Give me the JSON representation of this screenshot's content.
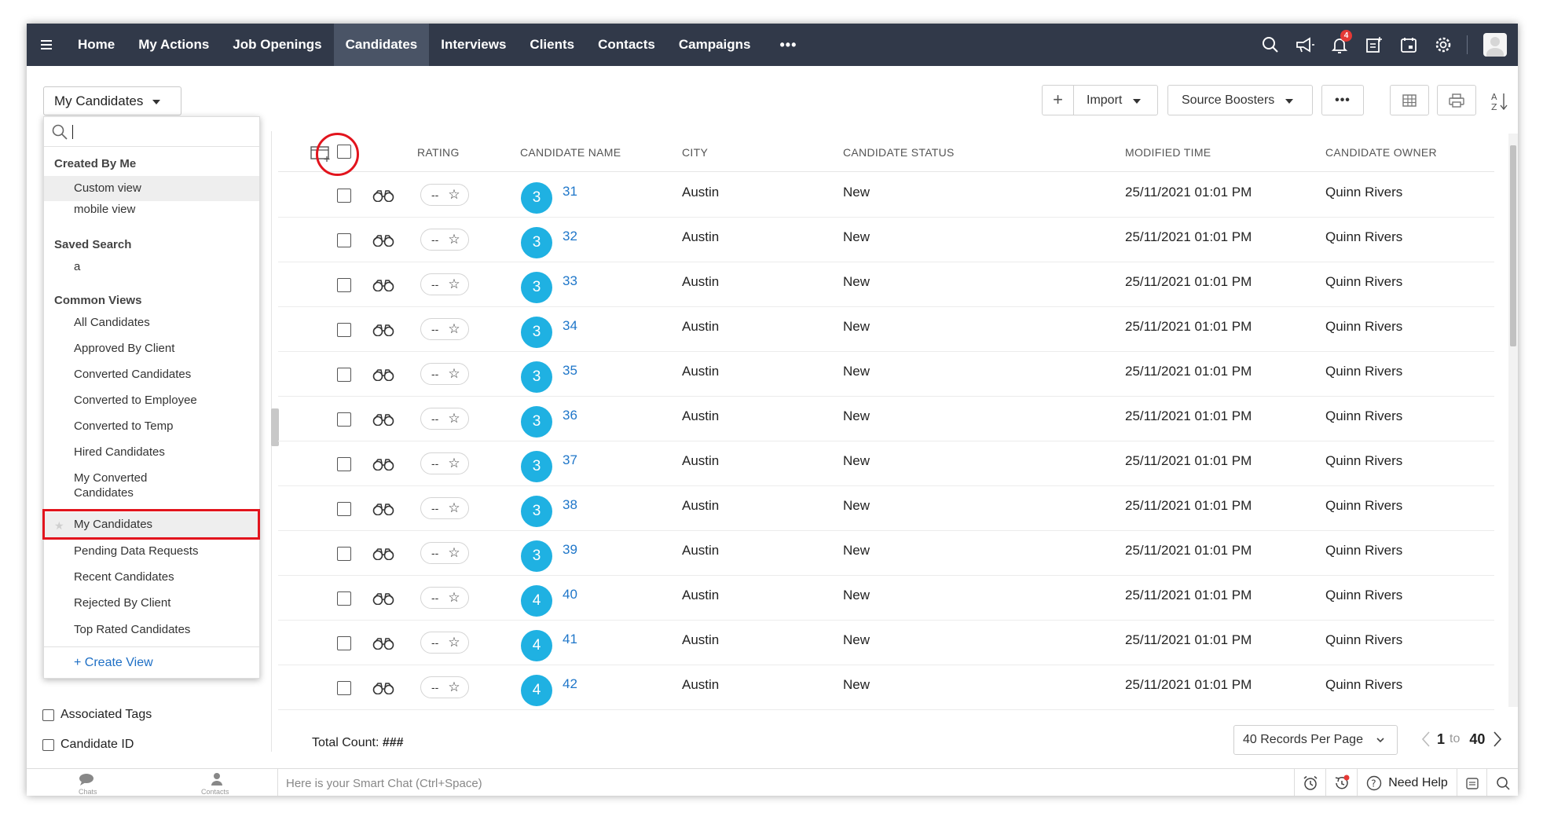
{
  "nav": {
    "tabs": [
      "Home",
      "My Actions",
      "Job Openings",
      "Candidates",
      "Interviews",
      "Clients",
      "Contacts",
      "Campaigns"
    ],
    "active": "Candidates",
    "more": "•••",
    "notification_count": "4"
  },
  "toolbar": {
    "view_select": "My Candidates",
    "plus": "+",
    "import": "Import",
    "source_boosters": "Source Boosters",
    "more": "•••"
  },
  "dropdown": {
    "search_placeholder": "",
    "created_by_me": "Created By Me",
    "created_items": [
      "Custom view",
      "mobile view"
    ],
    "saved_search": "Saved Search",
    "saved_items": [
      "a"
    ],
    "common_views": "Common Views",
    "common_items": [
      "All Candidates",
      "Approved By Client",
      "Converted Candidates",
      "Converted to Employee",
      "Converted to Temp",
      "Hired Candidates",
      "My Converted Candidates",
      "My Candidates",
      "Pending Data Requests",
      "Recent Candidates",
      "Rejected By Client",
      "Top Rated Candidates"
    ],
    "create_view": "+ Create View"
  },
  "left_panel": {
    "filters": [
      "Associated Tags",
      "Candidate ID"
    ]
  },
  "table": {
    "headers": {
      "rating": "RATING",
      "name": "CANDIDATE NAME",
      "city": "CITY",
      "status": "CANDIDATE STATUS",
      "modified": "MODIFIED TIME",
      "owner": "CANDIDATE OWNER"
    },
    "rows": [
      {
        "avatar": "3",
        "name": "31",
        "rating": "--",
        "city": "Austin",
        "status": "New",
        "modified": "25/11/2021 01:01 PM",
        "owner": "Quinn Rivers"
      },
      {
        "avatar": "3",
        "name": "32",
        "rating": "--",
        "city": "Austin",
        "status": "New",
        "modified": "25/11/2021 01:01 PM",
        "owner": "Quinn Rivers"
      },
      {
        "avatar": "3",
        "name": "33",
        "rating": "--",
        "city": "Austin",
        "status": "New",
        "modified": "25/11/2021 01:01 PM",
        "owner": "Quinn Rivers"
      },
      {
        "avatar": "3",
        "name": "34",
        "rating": "--",
        "city": "Austin",
        "status": "New",
        "modified": "25/11/2021 01:01 PM",
        "owner": "Quinn Rivers"
      },
      {
        "avatar": "3",
        "name": "35",
        "rating": "--",
        "city": "Austin",
        "status": "New",
        "modified": "25/11/2021 01:01 PM",
        "owner": "Quinn Rivers"
      },
      {
        "avatar": "3",
        "name": "36",
        "rating": "--",
        "city": "Austin",
        "status": "New",
        "modified": "25/11/2021 01:01 PM",
        "owner": "Quinn Rivers"
      },
      {
        "avatar": "3",
        "name": "37",
        "rating": "--",
        "city": "Austin",
        "status": "New",
        "modified": "25/11/2021 01:01 PM",
        "owner": "Quinn Rivers"
      },
      {
        "avatar": "3",
        "name": "38",
        "rating": "--",
        "city": "Austin",
        "status": "New",
        "modified": "25/11/2021 01:01 PM",
        "owner": "Quinn Rivers"
      },
      {
        "avatar": "3",
        "name": "39",
        "rating": "--",
        "city": "Austin",
        "status": "New",
        "modified": "25/11/2021 01:01 PM",
        "owner": "Quinn Rivers"
      },
      {
        "avatar": "4",
        "name": "40",
        "rating": "--",
        "city": "Austin",
        "status": "New",
        "modified": "25/11/2021 01:01 PM",
        "owner": "Quinn Rivers"
      },
      {
        "avatar": "4",
        "name": "41",
        "rating": "--",
        "city": "Austin",
        "status": "New",
        "modified": "25/11/2021 01:01 PM",
        "owner": "Quinn Rivers"
      },
      {
        "avatar": "4",
        "name": "42",
        "rating": "--",
        "city": "Austin",
        "status": "New",
        "modified": "25/11/2021 01:01 PM",
        "owner": "Quinn Rivers"
      }
    ]
  },
  "footer": {
    "total_label": "Total Count:",
    "total_value": "###",
    "per_page": "40 Records Per Page",
    "page_from": "1",
    "page_to_word": "to",
    "page_to": "40"
  },
  "bottom": {
    "chats": "Chats",
    "contacts": "Contacts",
    "smart_chat_placeholder": "Here is your Smart Chat (Ctrl+Space)",
    "need_help": "Need Help"
  },
  "colors": {
    "nav_bg": "#313949",
    "nav_active": "#4a5466",
    "avatar_bg": "#1fb1e2",
    "link": "#1e76c9",
    "highlight_red": "#e2141d",
    "badge_red": "#e53935"
  },
  "icons": [
    "menu-icon",
    "search-icon",
    "megaphone-icon",
    "bell-icon",
    "add-note-icon",
    "calendar-icon",
    "gear-icon",
    "user-avatar-icon",
    "plus-icon",
    "table-view-icon",
    "print-icon",
    "sort-az-icon",
    "column-settings-icon",
    "binoculars-icon",
    "star-icon",
    "chevron-left-icon",
    "chevron-right-icon",
    "alarm-icon",
    "history-icon",
    "help-icon"
  ]
}
